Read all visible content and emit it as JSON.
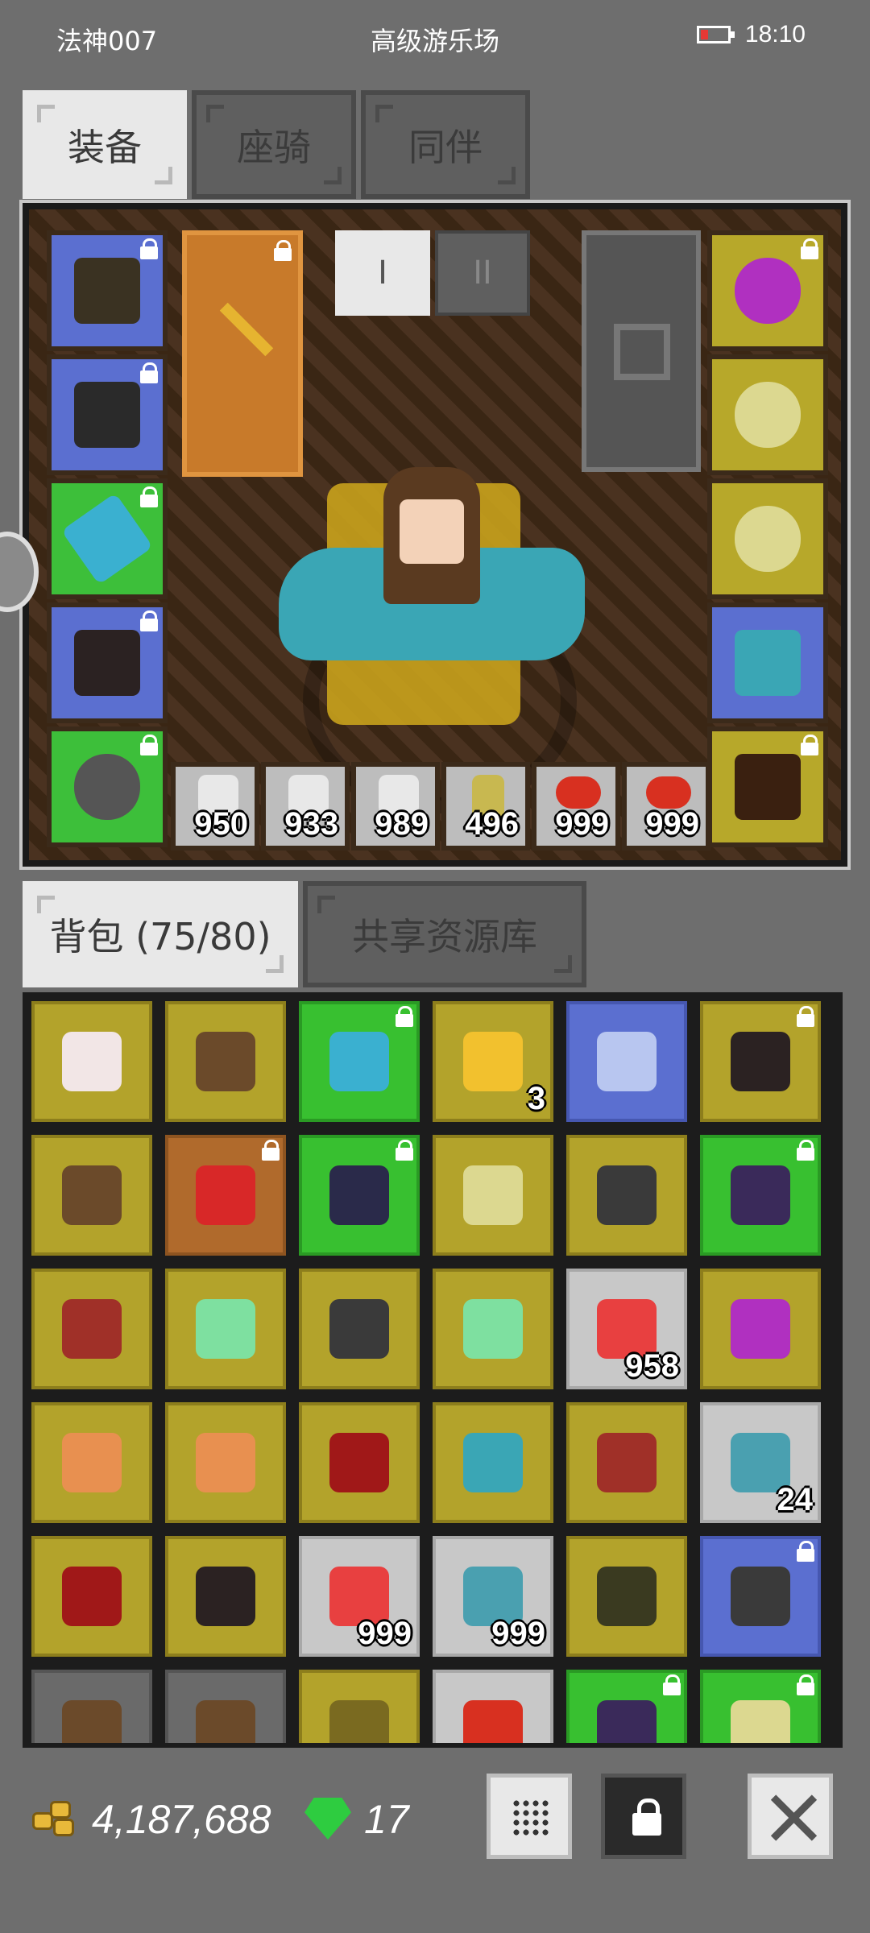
{
  "status_bar": {
    "player_name": "法神007",
    "location": "高级游乐场",
    "time": "18:10"
  },
  "top_tabs": [
    {
      "label": "装备",
      "active": true
    },
    {
      "label": "座骑",
      "active": false
    },
    {
      "label": "同伴",
      "active": false
    }
  ],
  "equipment": {
    "pager": [
      "I",
      "II"
    ],
    "left_slots": [
      {
        "icon": "hooded-helmet-icon",
        "rarity": "blue",
        "locked": true
      },
      {
        "icon": "spiked-armor-icon",
        "rarity": "blue",
        "locked": true
      },
      {
        "icon": "crystal-gauntlet-icon",
        "rarity": "green",
        "locked": true
      },
      {
        "icon": "dark-boots-icon",
        "rarity": "blue",
        "locked": true
      },
      {
        "icon": "spiked-belt-icon",
        "rarity": "green",
        "locked": true
      }
    ],
    "right_slots": [
      {
        "icon": "amethyst-necklace-icon",
        "rarity": "yellow",
        "locked": true
      },
      {
        "icon": "gold-ring-icon",
        "rarity": "yellow",
        "locked": false
      },
      {
        "icon": "gold-ring-icon",
        "rarity": "yellow",
        "locked": false
      },
      {
        "icon": "raptor-scroll-icon",
        "rarity": "blue",
        "locked": false
      },
      {
        "icon": "pet-portrait-icon",
        "rarity": "yellow",
        "locked": true
      }
    ],
    "weapon": {
      "icon": "golden-sword-icon",
      "rarity": "orange",
      "locked": true
    },
    "quickbar": [
      {
        "icon": "potion-icon",
        "qty": "950"
      },
      {
        "icon": "potion-icon",
        "qty": "933"
      },
      {
        "icon": "potion-icon",
        "qty": "989"
      },
      {
        "icon": "bottle-icon",
        "qty": "496"
      },
      {
        "icon": "meat-icon",
        "qty": "999"
      },
      {
        "icon": "meat-icon",
        "qty": "999"
      }
    ]
  },
  "bag_tabs": [
    {
      "label": "背包 (75/80)",
      "active": true
    },
    {
      "label": "共享资源库",
      "active": false
    }
  ],
  "bag": {
    "rows": [
      [
        {
          "icon": "egg-icon",
          "rarity": "yellow",
          "qty": "",
          "locked": false
        },
        {
          "icon": "club-icon",
          "rarity": "yellow",
          "qty": "",
          "locked": false
        },
        {
          "icon": "crystal-gauntlet-icon",
          "rarity": "green",
          "qty": "",
          "locked": true
        },
        {
          "icon": "gold-coin-icon",
          "rarity": "yellow",
          "qty": "3",
          "locked": false
        },
        {
          "icon": "blue-gem-icon",
          "rarity": "blue",
          "qty": "",
          "locked": false
        },
        {
          "icon": "dark-boots-icon",
          "rarity": "yellow",
          "qty": "",
          "locked": true
        }
      ],
      [
        {
          "icon": "wooden-staff-icon",
          "rarity": "yellow",
          "qty": "",
          "locked": false
        },
        {
          "icon": "ruby-amulet-icon",
          "rarity": "orange",
          "qty": "",
          "locked": true
        },
        {
          "icon": "dark-armor-icon",
          "rarity": "green",
          "qty": "",
          "locked": true
        },
        {
          "icon": "gold-ring-icon",
          "rarity": "yellow",
          "qty": "",
          "locked": false
        },
        {
          "icon": "iron-gauntlet-icon",
          "rarity": "yellow",
          "qty": "",
          "locked": false
        },
        {
          "icon": "shadow-belt-icon",
          "rarity": "green",
          "qty": "",
          "locked": true
        }
      ],
      [
        {
          "icon": "crimson-helmet-icon",
          "rarity": "yellow",
          "qty": "",
          "locked": false
        },
        {
          "icon": "jade-wand-icon",
          "rarity": "yellow",
          "qty": "",
          "locked": false
        },
        {
          "icon": "war-hammer-icon",
          "rarity": "yellow",
          "qty": "",
          "locked": false
        },
        {
          "icon": "jade-wand-icon",
          "rarity": "yellow",
          "qty": "",
          "locked": false
        },
        {
          "icon": "health-potion-icon",
          "rarity": "gray",
          "qty": "958",
          "locked": false
        },
        {
          "icon": "amethyst-necklace-icon",
          "rarity": "yellow",
          "qty": "",
          "locked": false
        }
      ],
      [
        {
          "icon": "fire-scroll-icon",
          "rarity": "yellow",
          "qty": "",
          "locked": false
        },
        {
          "icon": "fire-scroll-icon",
          "rarity": "yellow",
          "qty": "",
          "locked": false
        },
        {
          "icon": "red-boots-icon",
          "rarity": "yellow",
          "qty": "",
          "locked": false
        },
        {
          "icon": "raptor-scroll-icon",
          "rarity": "yellow",
          "qty": "",
          "locked": false
        },
        {
          "icon": "crimson-helmet-icon",
          "rarity": "yellow",
          "qty": "",
          "locked": false
        },
        {
          "icon": "fish-icon",
          "rarity": "gray",
          "qty": "24",
          "locked": false
        }
      ],
      [
        {
          "icon": "red-tunic-icon",
          "rarity": "yellow",
          "qty": "",
          "locked": false
        },
        {
          "icon": "dark-boots-icon",
          "rarity": "yellow",
          "qty": "",
          "locked": false
        },
        {
          "icon": "health-potion-icon",
          "rarity": "gray",
          "qty": "999",
          "locked": false
        },
        {
          "icon": "fish-icon",
          "rarity": "gray",
          "qty": "999",
          "locked": false
        },
        {
          "icon": "olive-belt-icon",
          "rarity": "yellow",
          "qty": "",
          "locked": false
        },
        {
          "icon": "iron-gauntlet-icon",
          "rarity": "blue",
          "qty": "",
          "locked": true
        }
      ],
      [
        {
          "icon": "wooden-staff-icon",
          "rarity": "darkgray",
          "qty": "",
          "locked": false
        },
        {
          "icon": "club-icon",
          "rarity": "darkgray",
          "qty": "",
          "locked": false
        },
        {
          "icon": "horned-helmet-icon",
          "rarity": "yellow",
          "qty": "",
          "locked": false
        },
        {
          "icon": "meat-icon",
          "rarity": "gray",
          "qty": "",
          "locked": false
        },
        {
          "icon": "shadow-cloak-icon",
          "rarity": "green",
          "qty": "",
          "locked": true
        },
        {
          "icon": "gold-ring-icon",
          "rarity": "green",
          "qty": "",
          "locked": true
        }
      ]
    ]
  },
  "footer": {
    "gold": "4,187,688",
    "gems": "17"
  }
}
